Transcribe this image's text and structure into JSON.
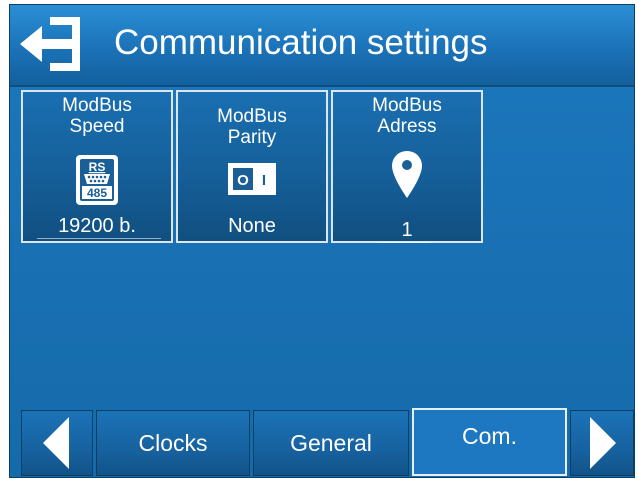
{
  "header": {
    "title": "Communication settings",
    "back_icon": "exit-arrow-icon"
  },
  "tiles": [
    {
      "label_line1": "ModBus",
      "label_line2": "Speed",
      "value": "19200 b.",
      "icon": "rs485-icon",
      "icon_text_top": "RS",
      "icon_text_bottom": "485"
    },
    {
      "label_line1": "ModBus",
      "label_line2": "Parity",
      "value": "None",
      "icon": "toggle-switch-icon",
      "switch_left": "O",
      "switch_right": "I"
    },
    {
      "label_line1": "ModBus",
      "label_line2": "Adress",
      "value": "1",
      "icon": "map-pin-icon"
    }
  ],
  "bottom_nav": {
    "prev_icon": "triangle-left-icon",
    "next_icon": "triangle-right-icon",
    "tabs": [
      {
        "label": "Clocks",
        "active": false
      },
      {
        "label": "General",
        "active": false
      },
      {
        "label": "Com.",
        "active": true
      }
    ]
  },
  "colors": {
    "panel_blue": "#1a72b6",
    "header_blue": "#2a8fd6",
    "border_light": "#dbe6f0",
    "text": "#ffffff"
  }
}
